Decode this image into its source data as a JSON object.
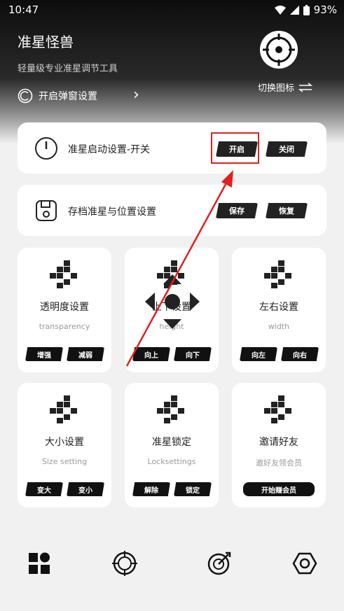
{
  "status": {
    "time": "10:47",
    "battery": "93%"
  },
  "header": {
    "title": "准星怪兽",
    "subtitle": "轻量级专业准星调节工具",
    "popup_setting": "开启弹窗设置",
    "switch_icon_label": "切换图标"
  },
  "power_row": {
    "label": "准星启动设置-开关",
    "on_label": "开启",
    "off_label": "关闭"
  },
  "save_row": {
    "label": "存档准星与位置设置",
    "save_label": "保存",
    "restore_label": "恢复"
  },
  "cards": {
    "transparency": {
      "title": "透明度设置",
      "sub": "transparency",
      "b1": "增强",
      "b2": "减弱"
    },
    "height": {
      "title": "上下设置",
      "sub": "height",
      "b1": "向上",
      "b2": "向下"
    },
    "width": {
      "title": "左右设置",
      "sub": "width",
      "b1": "向左",
      "b2": "向右"
    },
    "size": {
      "title": "大小设置",
      "sub": "Size setting",
      "b1": "变大",
      "b2": "变小"
    },
    "lock": {
      "title": "准星锁定",
      "sub": "Locksettings",
      "b1": "解除",
      "b2": "锁定"
    },
    "invite": {
      "title": "邀请好友",
      "sub": "邀好友领会员",
      "b1": "开始赚会员"
    }
  },
  "colors": {
    "accent": "#222222",
    "annotation": "#e02020"
  }
}
